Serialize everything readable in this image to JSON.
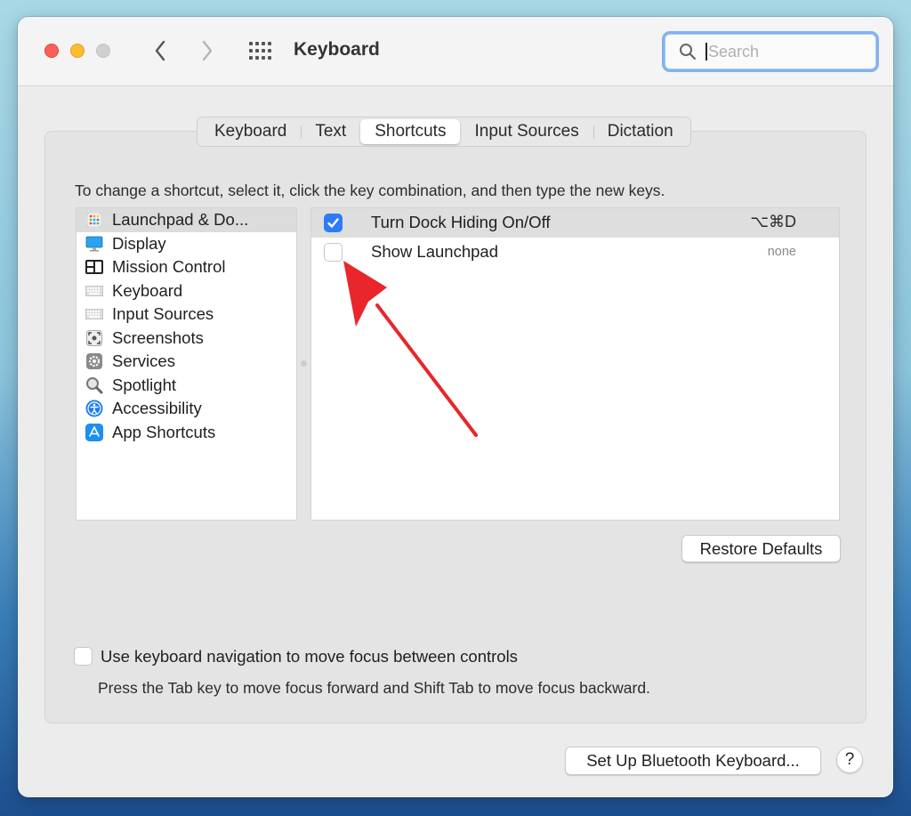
{
  "window": {
    "title": "Keyboard"
  },
  "search": {
    "placeholder": "Search"
  },
  "tabs": [
    {
      "label": "Keyboard",
      "active": false
    },
    {
      "label": "Text",
      "active": false
    },
    {
      "label": "Shortcuts",
      "active": true
    },
    {
      "label": "Input Sources",
      "active": false
    },
    {
      "label": "Dictation",
      "active": false
    }
  ],
  "instruction": "To change a shortcut, select it, click the key combination, and then type the new keys.",
  "categories": [
    {
      "label": "Launchpad & Do...",
      "icon": "launchpad-icon",
      "selected": true
    },
    {
      "label": "Display",
      "icon": "display-icon"
    },
    {
      "label": "Mission Control",
      "icon": "mission-control-icon"
    },
    {
      "label": "Keyboard",
      "icon": "keyboard-icon"
    },
    {
      "label": "Input Sources",
      "icon": "keyboard-icon"
    },
    {
      "label": "Screenshots",
      "icon": "screenshot-icon"
    },
    {
      "label": "Services",
      "icon": "gear-icon"
    },
    {
      "label": "Spotlight",
      "icon": "magnifier-icon"
    },
    {
      "label": "Accessibility",
      "icon": "accessibility-icon"
    },
    {
      "label": "App Shortcuts",
      "icon": "app-store-icon"
    }
  ],
  "shortcuts": [
    {
      "label": "Turn Dock Hiding On/Off",
      "checked": true,
      "keys": "⌥⌘D"
    },
    {
      "label": "Show Launchpad",
      "checked": false,
      "keys": "none"
    }
  ],
  "buttons": {
    "restore": "Restore Defaults",
    "bluetooth": "Set Up Bluetooth Keyboard...",
    "help": "?"
  },
  "keyboard_nav": {
    "label": "Use keyboard navigation to move focus between controls",
    "checked": false,
    "hint": "Press the Tab key to move focus forward and Shift Tab to move focus backward."
  },
  "colors": {
    "accent": "#2d7cf6",
    "annotation_arrow": "#e8262b"
  }
}
